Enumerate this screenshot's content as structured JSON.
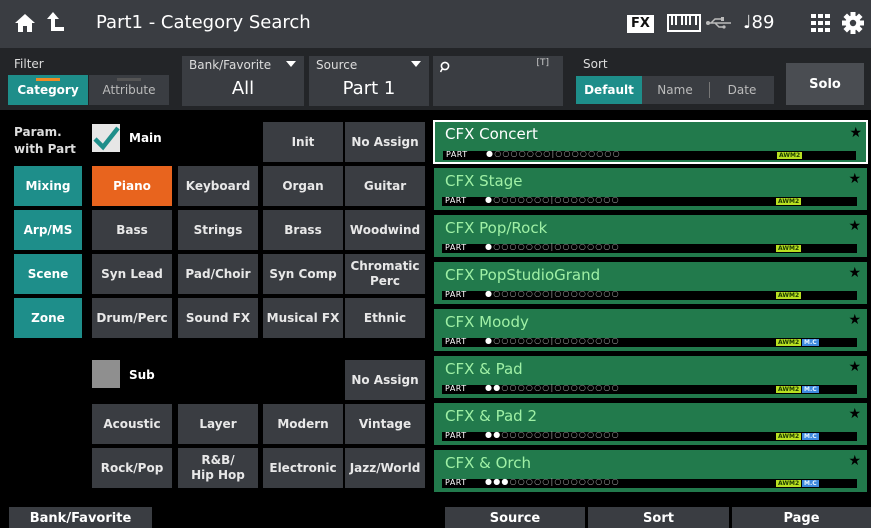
{
  "header": {
    "title": "Part1 - Category Search",
    "fx_label": "FX",
    "tempo": "♩89"
  },
  "filter": {
    "label": "Filter",
    "tabs": [
      "Category",
      "Attribute"
    ]
  },
  "bank": {
    "label": "Bank/Favorite",
    "value": "All"
  },
  "source": {
    "label": "Source",
    "value": "Part 1"
  },
  "search": {
    "placeholder": "",
    "keyboard_hint": "[T]"
  },
  "sort": {
    "label": "Sort",
    "options": [
      "Default",
      "Name",
      "Date"
    ],
    "selected": "Default"
  },
  "solo_label": "Solo",
  "param_label": [
    "Param.",
    "with Part"
  ],
  "left_buttons": [
    "Mixing",
    "Arp/MS",
    "Scene",
    "Zone"
  ],
  "main": {
    "checkbox_label": "Main",
    "checked": true,
    "top_buttons": [
      "Init",
      "No Assign"
    ],
    "categories": [
      [
        "Piano",
        "Keyboard",
        "Organ",
        "Guitar"
      ],
      [
        "Bass",
        "Strings",
        "Brass",
        "Woodwind"
      ],
      [
        "Syn Lead",
        "Pad/Choir",
        "Syn Comp",
        "Chromatic\nPerc"
      ],
      [
        "Drum/Perc",
        "Sound FX",
        "Musical FX",
        "Ethnic"
      ]
    ],
    "selected": "Piano"
  },
  "sub": {
    "checkbox_label": "Sub",
    "checked": false,
    "no_assign_label": "No Assign",
    "categories": [
      [
        "Acoustic",
        "Layer",
        "Modern",
        "Vintage"
      ],
      [
        "Rock/Pop",
        "R&B/\nHip Hop",
        "Electronic",
        "Jazz/World"
      ]
    ]
  },
  "results": [
    {
      "name": "CFX Concert",
      "parts": 1,
      "awm": "AWM2",
      "mc": ""
    },
    {
      "name": "CFX Stage",
      "parts": 1,
      "awm": "AWM2",
      "mc": ""
    },
    {
      "name": "CFX Pop/Rock",
      "parts": 1,
      "awm": "AWM2",
      "mc": ""
    },
    {
      "name": "CFX PopStudioGrand",
      "parts": 1,
      "awm": "AWM2",
      "mc": ""
    },
    {
      "name": "CFX Moody",
      "parts": 1,
      "awm": "AWM2",
      "mc": "M.C"
    },
    {
      "name": "CFX & Pad",
      "parts": 2,
      "awm": "AWM2",
      "mc": "M.C"
    },
    {
      "name": "CFX & Pad 2",
      "parts": 2,
      "awm": "AWM2",
      "mc": "M.C"
    },
    {
      "name": "CFX & Orch",
      "parts": 3,
      "awm": "AWM2",
      "mc": "M.C"
    }
  ],
  "part_label": "PART",
  "footer": {
    "bank_favorite": "Bank/Favorite",
    "source": "Source",
    "sort": "Sort",
    "page": "Page"
  },
  "colors": {
    "teal": "#1e8e8a",
    "orange": "#e8641e",
    "result_green": "#227a4c"
  }
}
